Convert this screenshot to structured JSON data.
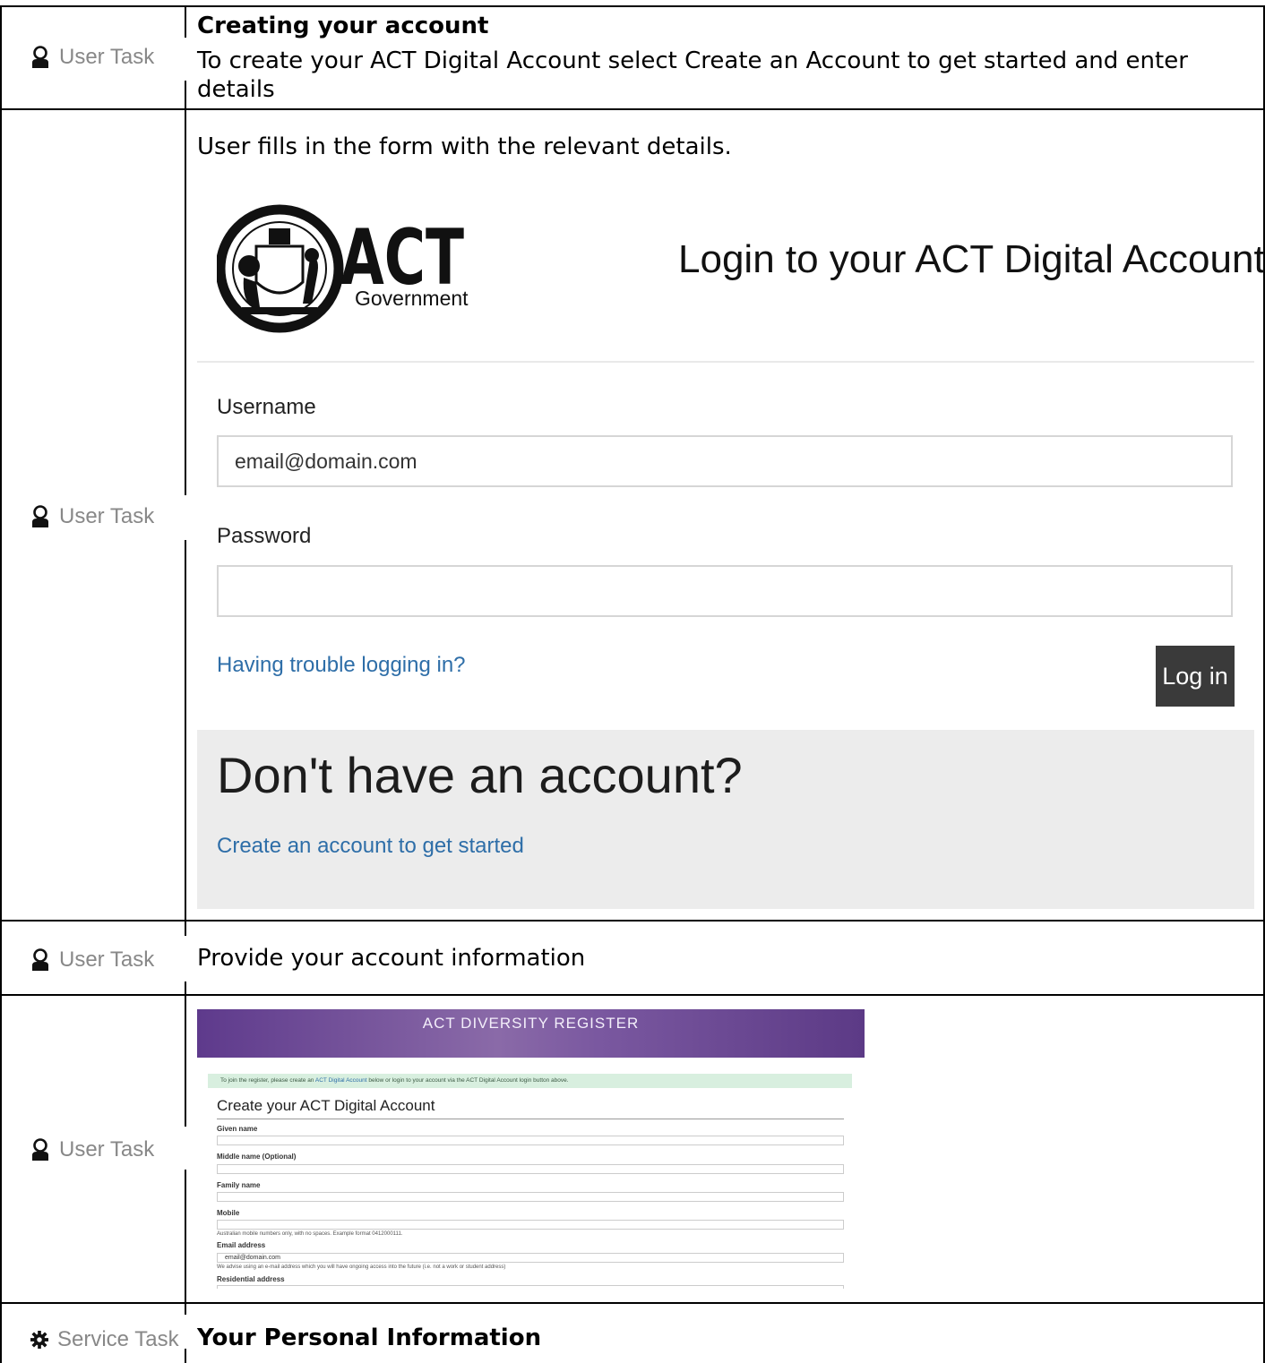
{
  "rows": [
    {
      "task_label": "User Task",
      "heading": "Creating your account",
      "text": "To create your ACT Digital Account select Create an Account to get started and enter details"
    },
    {
      "task_label": "User Task",
      "text": "User fills in the form with the relevant details."
    },
    {
      "task_label": "User Task",
      "text": "Provide your account information"
    },
    {
      "task_label": "User Task"
    },
    {
      "task_label": "Service Task",
      "heading": "Your Personal Information"
    }
  ],
  "login": {
    "logo_text": "ACT",
    "logo_sub": "Government",
    "title": "Login to your ACT Digital Account",
    "username_label": "Username",
    "username_value": "email@domain.com",
    "password_label": "Password",
    "password_value": "",
    "trouble_link": "Having trouble logging in?",
    "login_button": "Log in",
    "no_account_heading": "Don't have an account?",
    "create_link": "Create an account to get started"
  },
  "register": {
    "banner": "ACT DIVERSITY REGISTER",
    "note_pre": "To join the register, please create an ",
    "note_link": "ACT Digital Account",
    "note_post": " below or login to your account via the ACT Digital Account login button above.",
    "title": "Create your ACT Digital Account",
    "given_name": "Given name",
    "middle_name": "Middle name (Optional)",
    "family_name": "Family name",
    "mobile": "Mobile",
    "mobile_hint": "Australian mobile numbers only, with no spaces. Example format 0412000111.",
    "email_label": "Email address",
    "email_value": "email@domain.com",
    "email_hint": "We advise using an e-mail address which you will have ongoing access into the future (i.e. not a work or student address)",
    "residential": "Residential address"
  },
  "icons": {
    "user": "user-icon",
    "service": "gear-icon"
  }
}
